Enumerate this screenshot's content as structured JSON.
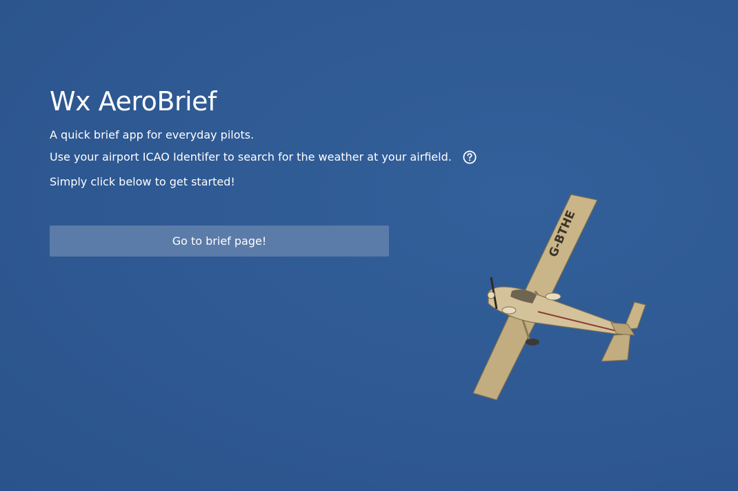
{
  "app": {
    "title": "Wx AeroBrief",
    "tagline": "A quick brief app for everyday pilots.",
    "instructions": "Use your airport ICAO Identifer to search for the weather at your airfield.",
    "cta_text": "Simply click below to get started!",
    "help_icon": "question-circle-icon"
  },
  "button": {
    "label": "Go to brief page!"
  },
  "hero_image": {
    "registration": "G-BTHE"
  },
  "colors": {
    "background": "#2f5a94",
    "button": "#5b7ba8",
    "text": "#ffffff"
  }
}
